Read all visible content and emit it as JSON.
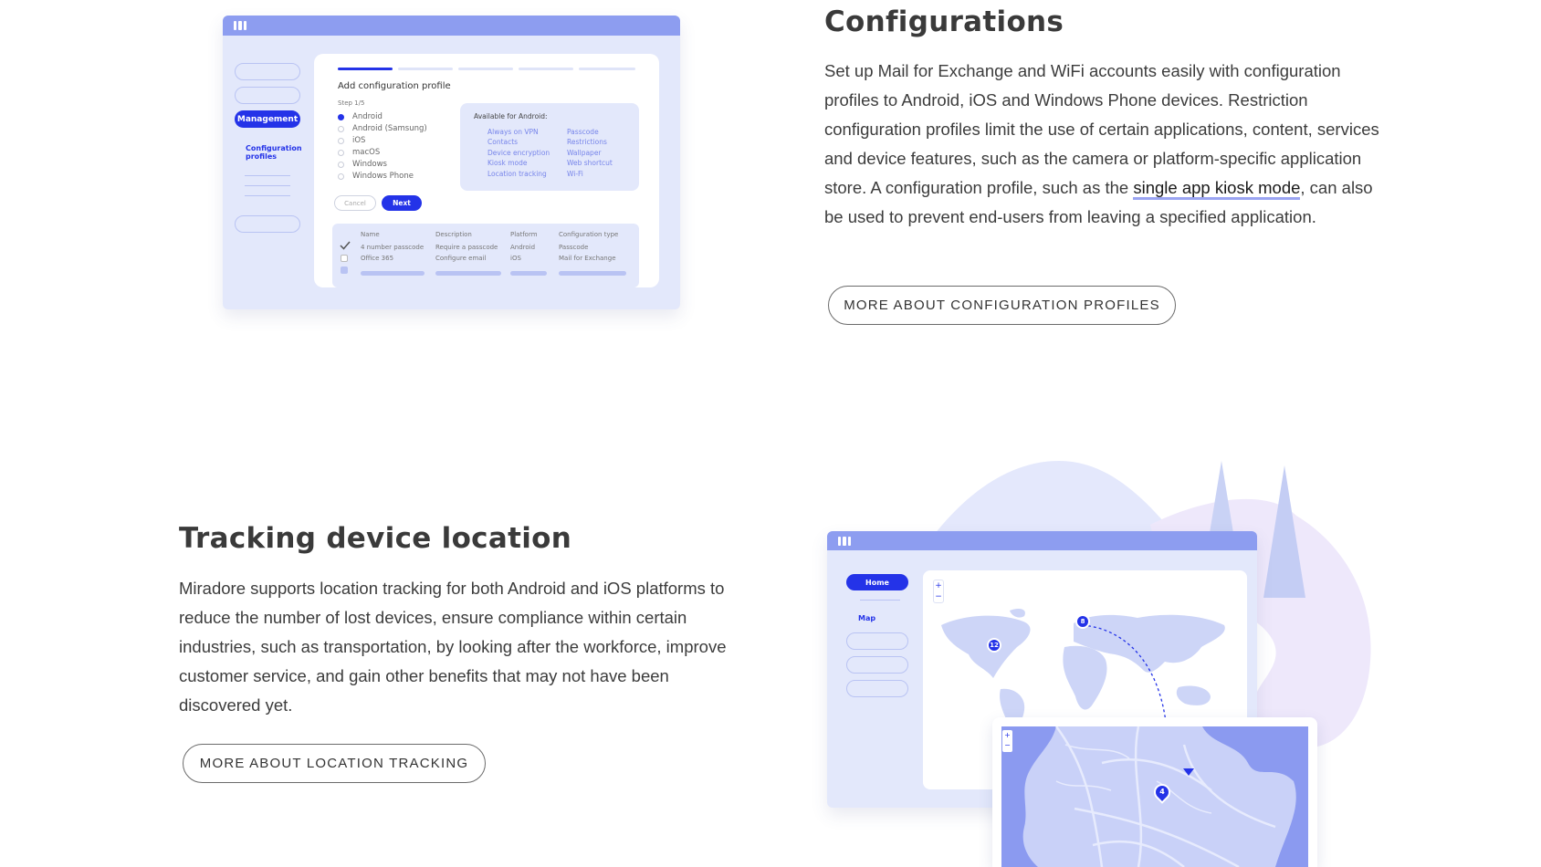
{
  "configurations": {
    "heading": "Configurations",
    "para_before_link": "Set up Mail for Exchange and WiFi accounts easily with configuration profiles to Android, iOS and Windows Phone devices. Restriction configuration profiles limit the use of certain applications, content, services and device features, such as the camera or platform-specific application store. A configuration profile, such as the ",
    "link_text": "single app kiosk mode",
    "para_after_link": ", can also be used to prevent end-users from leaving a specified application.",
    "button_label": "MORE ABOUT CONFIGURATION PROFILES"
  },
  "tracking": {
    "heading": "Tracking device location",
    "paragraph": "Miradore supports location tracking for both Android and iOS platforms to reduce the number of lost devices, ensure compliance within certain industries, such as transportation, by looking after the workforce, improve customer service, and gain other benefits that may not have been discovered yet.",
    "button_label": "MORE ABOUT LOCATION TRACKING"
  },
  "mock_config": {
    "sidebar_active": "Management",
    "sidebar_link": "Configuration profiles",
    "title": "Add configuration profile",
    "step": "Step 1/5",
    "platforms": [
      "Android",
      "Android (Samsung)",
      "iOS",
      "macOS",
      "Windows",
      "Windows Phone"
    ],
    "selected_platform": "Android",
    "available_title": "Available for Android:",
    "available_col1": [
      "Always on VPN",
      "Contacts",
      "Device encryption",
      "Kiosk mode",
      "Location tracking"
    ],
    "available_col2": [
      "Passcode",
      "Restrictions",
      "Wallpaper",
      "Web shortcut",
      "Wi-Fi"
    ],
    "cancel_label": "Cancel",
    "next_label": "Next",
    "table_headers": [
      "Name",
      "Description",
      "Platform",
      "Configuration type"
    ],
    "table_rows": [
      [
        "4 number passcode",
        "Require a passcode",
        "Android",
        "Passcode"
      ],
      [
        "Office 365",
        "Configure email",
        "iOS",
        "Mail for Exchange"
      ]
    ]
  },
  "mock_map": {
    "sidebar_active": "Home",
    "sidebar_link": "Map",
    "zoom_in": "+",
    "zoom_out": "−",
    "markers": [
      "12",
      "8"
    ],
    "detail_marker": "4"
  },
  "colors": {
    "accent": "#2433e8",
    "soft_blue": "#e3e8fb",
    "mid_blue": "#8d9df0",
    "link_underline": "#9aa4f2"
  }
}
